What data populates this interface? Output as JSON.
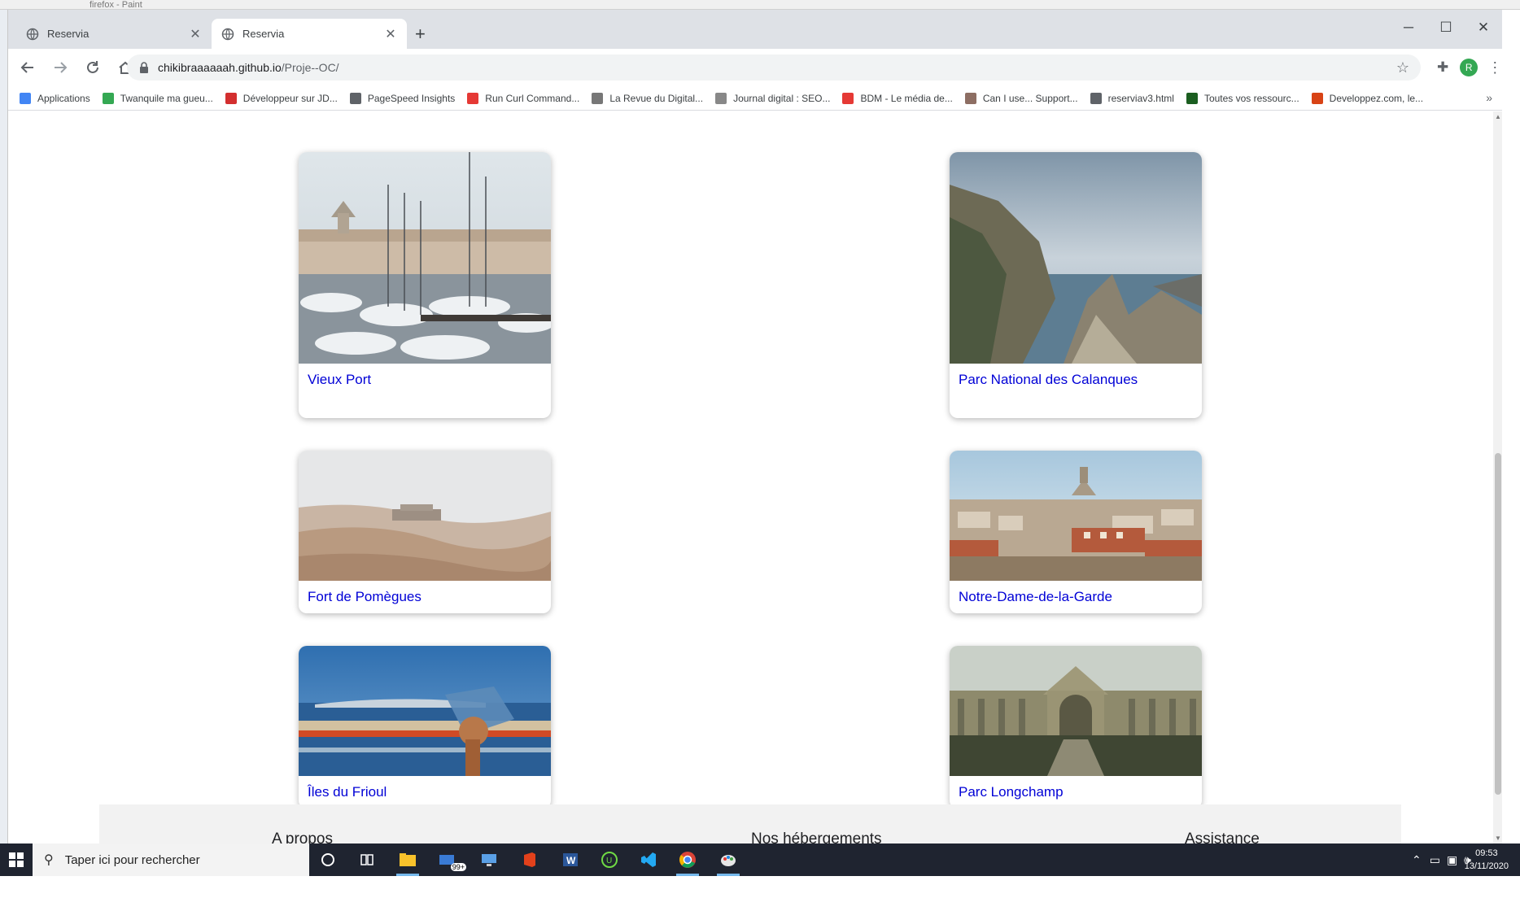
{
  "background_app": {
    "title": "firefox - Paint"
  },
  "browser": {
    "tabs": [
      {
        "label": "Reservia",
        "active": false
      },
      {
        "label": "Reservia",
        "active": true
      }
    ],
    "new_tab_label": "+",
    "window_controls": {
      "minimize": "─",
      "maximize": "☐",
      "close": "✕"
    },
    "url": {
      "host": "chikibraaaaaah.github.io",
      "path": "/Proje--OC/"
    },
    "profile_initial": "R",
    "bookmarks": [
      {
        "label": "Applications",
        "icon": "apps-grid-icon",
        "color": "#4285f4"
      },
      {
        "label": "Twanquile ma gueu...",
        "icon": "plus-square-icon",
        "color": "#34a853"
      },
      {
        "label": "Développeur sur JD...",
        "icon": "jdn-icon",
        "color": "#d32f2f"
      },
      {
        "label": "PageSpeed Insights",
        "icon": "code-icon",
        "color": "#5f6368"
      },
      {
        "label": "Run Curl Command...",
        "icon": "curl-icon",
        "color": "#e53935"
      },
      {
        "label": "La Revue du Digital...",
        "icon": "revue-icon",
        "color": "#777777"
      },
      {
        "label": "Journal digital : SEO...",
        "icon": "globe-icon",
        "color": "#888888"
      },
      {
        "label": "BDM - Le média de...",
        "icon": "bdm-icon",
        "color": "#e53935"
      },
      {
        "label": "Can I use... Support...",
        "icon": "caniuse-icon",
        "color": "#8d6e63"
      },
      {
        "label": "reserviav3.html",
        "icon": "globe-icon",
        "color": "#5f6368"
      },
      {
        "label": "Toutes vos ressourc...",
        "icon": "leaf-icon",
        "color": "#1b5e20"
      },
      {
        "label": "Developpez.com, le...",
        "icon": "developpez-icon",
        "color": "#d84315"
      }
    ],
    "bookmarks_overflow": "»"
  },
  "page": {
    "cards": [
      {
        "label": "Vieux Port",
        "icon": "port-boats-image"
      },
      {
        "label": "Parc National des Calanques",
        "icon": "cliffs-sea-image"
      },
      {
        "label": "Fort de Pomègues",
        "icon": "rocky-fort-image"
      },
      {
        "label": "Notre-Dame-de-la-Garde",
        "icon": "city-basilica-image"
      },
      {
        "label": "Îles du Frioul",
        "icon": "telescope-sea-image"
      },
      {
        "label": "Parc Longchamp",
        "icon": "palace-gardens-image"
      }
    ],
    "footer": {
      "columns": [
        "A propos",
        "Nos hébergements",
        "Assistance"
      ]
    }
  },
  "taskbar": {
    "search_placeholder": "Taper ici pour rechercher",
    "mail_badge": "99+",
    "clock": {
      "time": "09:53",
      "date": "13/11/2020"
    }
  },
  "colors": {
    "link": "#0000d6",
    "tabbar": "#dee1e6",
    "taskbar": "#1f2430"
  }
}
